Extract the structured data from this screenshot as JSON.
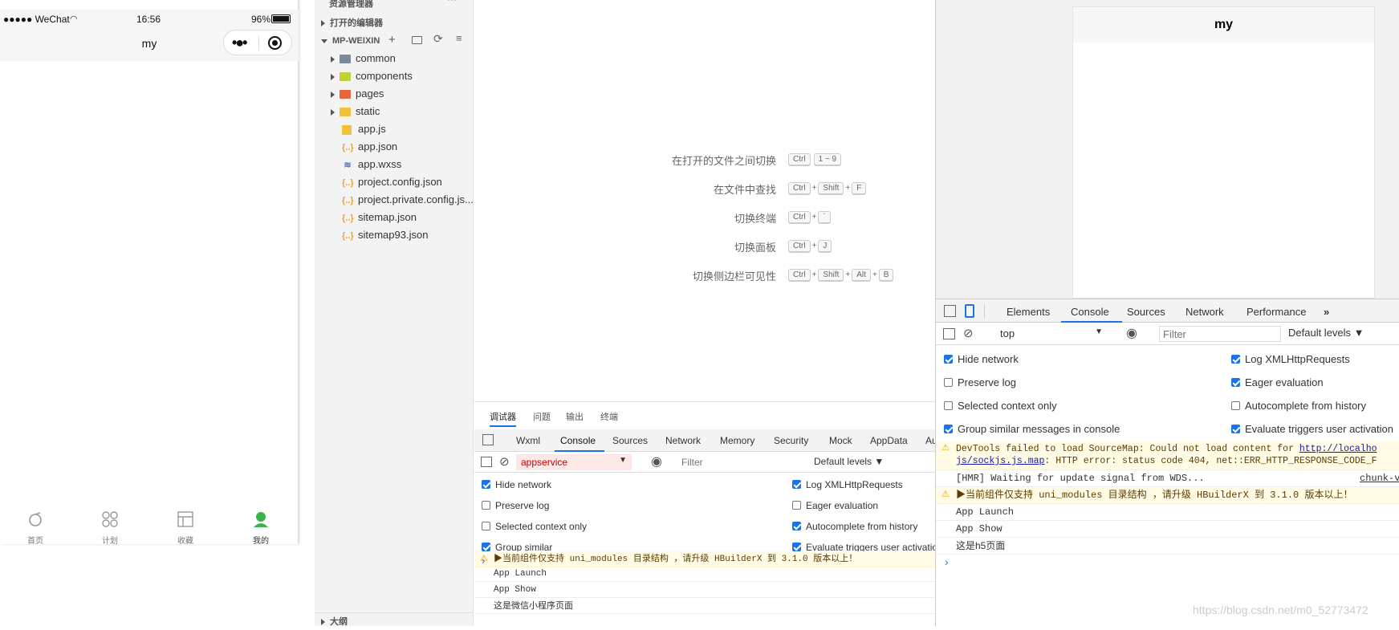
{
  "phone": {
    "carrier": "●●●●● WeChat",
    "time": "16:56",
    "battery": "96%",
    "title": "my",
    "tabs": [
      {
        "label": "首页",
        "icon": "home-icon"
      },
      {
        "label": "计划",
        "icon": "plan-icon"
      },
      {
        "label": "收藏",
        "icon": "collect-icon"
      },
      {
        "label": "我的",
        "icon": "profile-icon"
      }
    ]
  },
  "explorer": {
    "top_title": "资源管理器",
    "open_editors": "打开的编辑器",
    "project": "MP-WEIXIN",
    "outline": "大纲",
    "items": [
      {
        "label": "common",
        "type": "folder",
        "color": "#7b8a99"
      },
      {
        "label": "components",
        "type": "folder",
        "color": "#c3cf3a"
      },
      {
        "label": "pages",
        "type": "folder",
        "color": "#e8643d"
      },
      {
        "label": "static",
        "type": "folder",
        "color": "#f0c23b"
      },
      {
        "label": "app.js",
        "type": "js"
      },
      {
        "label": "app.json",
        "type": "json"
      },
      {
        "label": "app.wxss",
        "type": "wxss"
      },
      {
        "label": "project.config.json",
        "type": "json"
      },
      {
        "label": "project.private.config.js...",
        "type": "json"
      },
      {
        "label": "sitemap.json",
        "type": "json"
      },
      {
        "label": "sitemap93.json",
        "type": "json"
      }
    ]
  },
  "welcome": {
    "shortcuts": [
      {
        "label": "在打开的文件之间切换",
        "keys": [
          "Ctrl",
          "1 ~ 9"
        ],
        "seps": [
          ""
        ]
      },
      {
        "label": "在文件中查找",
        "keys": [
          "Ctrl",
          "Shift",
          "F"
        ],
        "seps": [
          "+",
          "+"
        ]
      },
      {
        "label": "切换终端",
        "keys": [
          "Ctrl",
          "`"
        ],
        "seps": [
          "+"
        ]
      },
      {
        "label": "切换面板",
        "keys": [
          "Ctrl",
          "J"
        ],
        "seps": [
          "+"
        ]
      },
      {
        "label": "切换侧边栏可见性",
        "keys": [
          "Ctrl",
          "Shift",
          "Alt",
          "B"
        ],
        "seps": [
          "+",
          "+",
          "+"
        ]
      }
    ]
  },
  "debugger": {
    "top_tabs": [
      "调试器",
      "问题",
      "输出",
      "终端"
    ],
    "tabs": [
      "Wxml",
      "Console",
      "Sources",
      "Network",
      "Memory",
      "Security",
      "Mock",
      "AppData",
      "Au"
    ],
    "context": "appservice",
    "filter_placeholder": "Filter",
    "levels": "Default levels ▼",
    "options_left": [
      {
        "label": "Hide network",
        "checked": true
      },
      {
        "label": "Preserve log",
        "checked": false
      },
      {
        "label": "Selected context only",
        "checked": false
      },
      {
        "label": "Group similar",
        "checked": true
      }
    ],
    "options_right": [
      {
        "label": "Log XMLHttpRequests",
        "checked": true
      },
      {
        "label": "Eager evaluation",
        "checked": false
      },
      {
        "label": "Autocomplete from history",
        "checked": true
      },
      {
        "label": "Evaluate triggers user activation",
        "checked": true
      }
    ],
    "logs": [
      {
        "text": "▶当前组件仅支持 uni_modules 目录结构 ，请升级 HBuilderX 到 3.1.0 版本以上！",
        "warn": true
      },
      {
        "text": "App Launch",
        "warn": false
      },
      {
        "text": "App Show",
        "warn": false
      },
      {
        "text": "这是微信小程序页面",
        "warn": false
      }
    ]
  },
  "right": {
    "preview_title": "my",
    "tabs": [
      "Elements",
      "Console",
      "Sources",
      "Network",
      "Performance",
      "»"
    ],
    "context": "top",
    "filter_placeholder": "Filter",
    "levels": "Default levels ▼",
    "options_left": [
      {
        "label": "Hide network",
        "checked": true
      },
      {
        "label": "Preserve log",
        "checked": false
      },
      {
        "label": "Selected context only",
        "checked": false
      },
      {
        "label": "Group similar messages in console",
        "checked": true
      }
    ],
    "options_right": [
      {
        "label": "Log XMLHttpRequests",
        "checked": true
      },
      {
        "label": "Eager evaluation",
        "checked": true
      },
      {
        "label": "Autocomplete from history",
        "checked": false
      },
      {
        "label": "Evaluate triggers user activation",
        "checked": true
      }
    ],
    "log_sourcemap_1": "DevTools failed to load SourceMap: Could not load content for ",
    "log_sourcemap_link": "http://localho",
    "log_sourcemap_2_link": "js/sockjs.js.map",
    "log_sourcemap_2": ": HTTP error: status code 404, net::ERR_HTTP_RESPONSE_CODE_F",
    "log_hmr": "[HMR] Waiting for update signal from WDS...",
    "log_hmr_src": "chunk-v",
    "log_warn": "▶当前组件仅支持 uni_modules 目录结构 ，请升级 HBuilderX 到 3.1.0 版本以上！",
    "log_launch": "App Launch",
    "log_show": "App Show",
    "log_page": "这是h5页面",
    "prompt": "›"
  },
  "watermark": "https://blog.csdn.net/m0_52773472"
}
